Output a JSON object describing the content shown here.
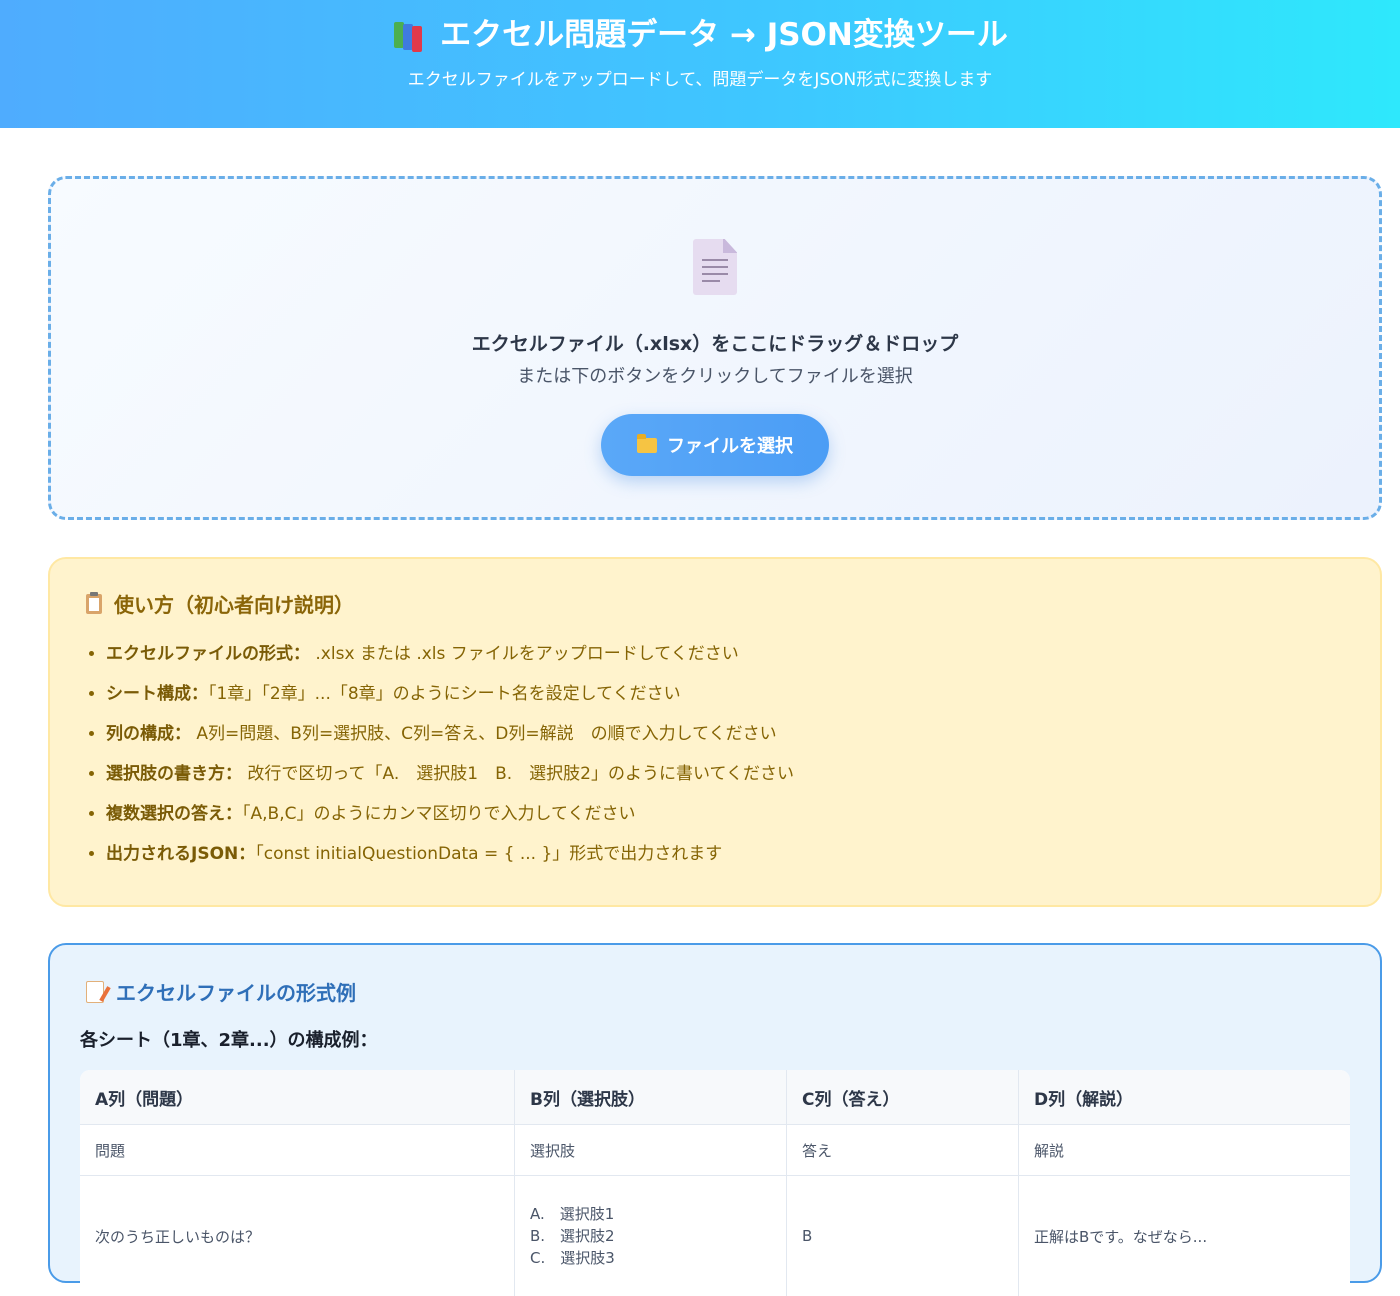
{
  "header": {
    "title": "エクセル問題データ → JSON変換ツール",
    "subtitle": "エクセルファイルをアップロードして、問題データをJSON形式に変換します"
  },
  "dropzone": {
    "title": "エクセルファイル（.xlsx）をここにドラッグ＆ドロップ",
    "subtitle": "または下のボタンをクリックしてファイルを選択",
    "button_label": "ファイルを選択"
  },
  "howto": {
    "title": "使い方（初心者向け説明）",
    "items": [
      {
        "label": "エクセルファイルの形式：",
        "text": " .xlsx または .xls ファイルをアップロードしてください"
      },
      {
        "label": "シート構成：",
        "text": "「1章」「2章」...「8章」のようにシート名を設定してください"
      },
      {
        "label": "列の構成：",
        "text": " A列=問題、B列=選択肢、C列=答え、D列=解説　の順で入力してください"
      },
      {
        "label": "選択肢の書き方：",
        "text": " 改行で区切って「A.　選択肢1　B.　選択肢2」のように書いてください"
      },
      {
        "label": "複数選択の答え：",
        "text": "「A,B,C」のようにカンマ区切りで入力してください"
      },
      {
        "label": "出力されるJSON：",
        "text": "「const initialQuestionData = { ... }」形式で出力されます"
      }
    ]
  },
  "example": {
    "title": "エクセルファイルの形式例",
    "subtitle": "各シート（1章、2章...）の構成例：",
    "columns": [
      "A列（問題）",
      "B列（選択肢）",
      "C列（答え）",
      "D列（解説）"
    ],
    "header_row": [
      "問題",
      "選択肢",
      "答え",
      "解説"
    ],
    "example_row": {
      "question": "次のうち正しいものは？",
      "choices": [
        "A.　選択肢1",
        "B.　選択肢2",
        "C.　選択肢3"
      ],
      "answer": "B",
      "explanation": "正解はBです。なぜなら..."
    }
  },
  "colors": {
    "header_gradient_start": "#4facfe",
    "header_gradient_end": "#2ee8fc",
    "dropzone_border": "#6aaee8",
    "button": "#4b9df5",
    "howto_bg": "#fff3cd",
    "howto_text": "#856404",
    "example_border": "#4a9be8",
    "example_title": "#2f6fb8"
  },
  "icons": {
    "header": "books-icon",
    "dropzone": "document-icon",
    "button": "folder-icon",
    "howto": "clipboard-icon",
    "example": "memo-icon"
  }
}
